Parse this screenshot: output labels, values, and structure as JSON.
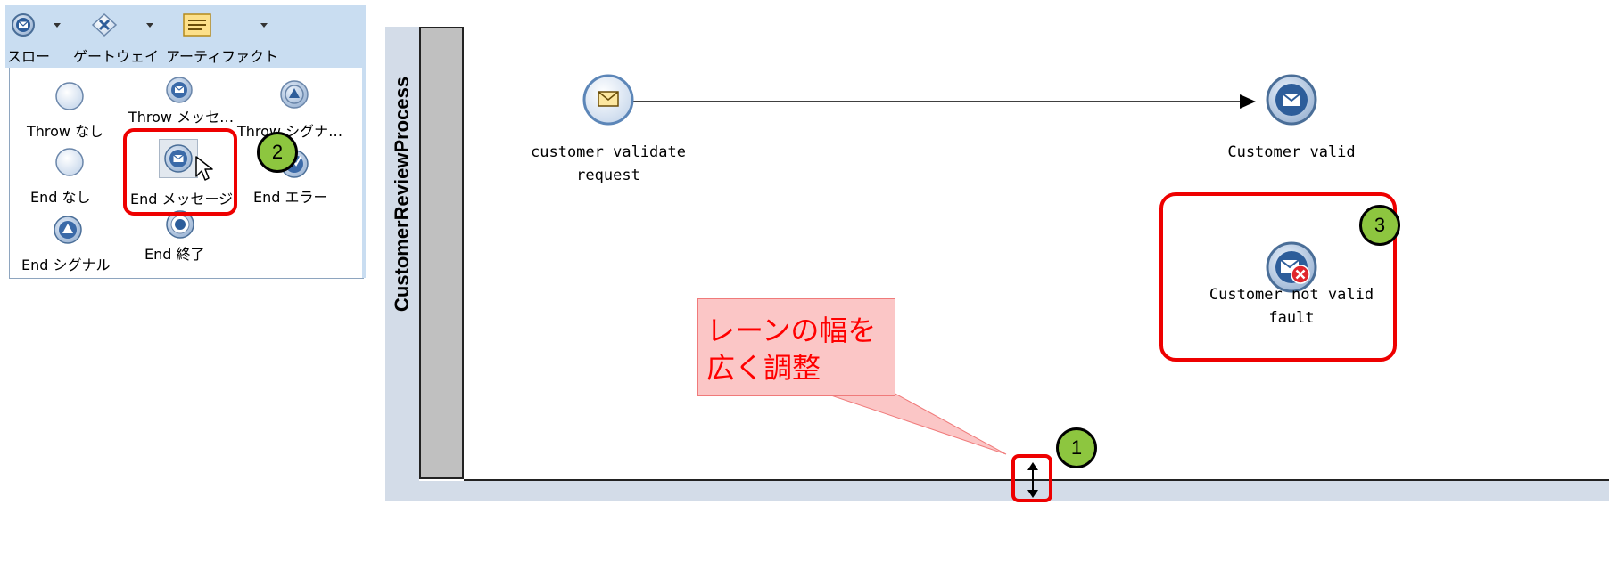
{
  "toolbar": {
    "buttons": [
      {
        "label": "スロー",
        "icon": "message-event-icon"
      },
      {
        "label": "ゲートウェイ",
        "icon": "exclusive-gateway-icon"
      },
      {
        "label": "アーティファクト",
        "icon": "note-artifact-icon"
      }
    ]
  },
  "palette": {
    "items": [
      {
        "label": "Throw なし",
        "icon": "empty-event-icon"
      },
      {
        "label": "Throw メッセ…",
        "icon": "message-event-icon"
      },
      {
        "label": "Throw シグナ…",
        "icon": "signal-event-icon"
      },
      {
        "label": "End なし",
        "icon": "empty-event-icon"
      },
      {
        "label": "End メッセージ",
        "icon": "message-event-icon"
      },
      {
        "label": "End エラー",
        "icon": "error-event-icon"
      },
      {
        "label": "End シグナル",
        "icon": "signal-event-icon"
      },
      {
        "label": "End 終了",
        "icon": "terminate-event-icon"
      }
    ]
  },
  "canvas": {
    "pool_title": "CustomerReviewProcess",
    "start_event_label_line1": "customer validate",
    "start_event_label_line2": "request",
    "end_event_label": "Customer valid",
    "error_event_label_line1": "Customer not valid",
    "error_event_label_line2": "fault"
  },
  "callout": {
    "line1": "レーンの幅を",
    "line2": "広く調整"
  },
  "badges": [
    "1",
    "2",
    "3"
  ],
  "colors": {
    "highlight": "#ee0000",
    "badge": "#8dc63f",
    "callout_bg": "#fbc6c6",
    "callout_text": "#ff0000",
    "toolbar_bg": "#c9ddf1"
  }
}
